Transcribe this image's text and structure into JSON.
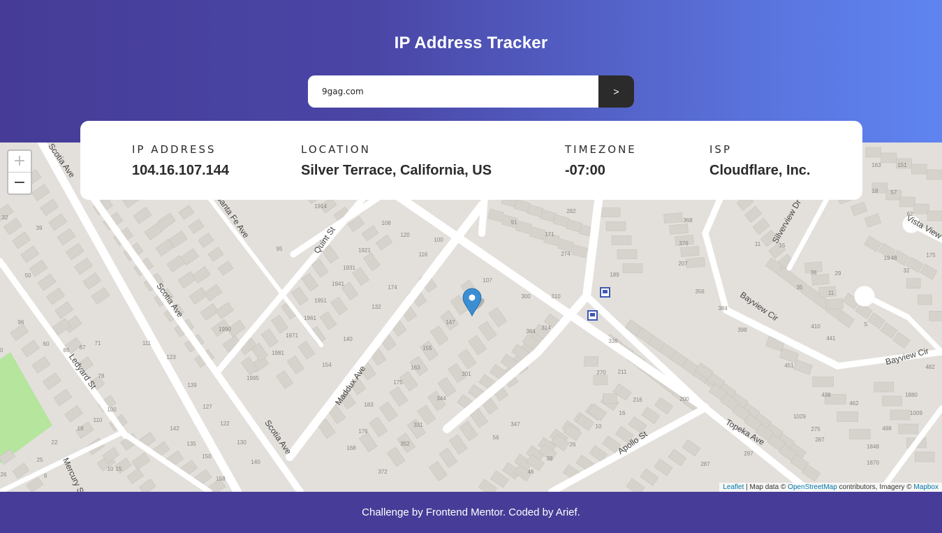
{
  "header": {
    "title": "IP Address Tracker"
  },
  "search": {
    "value": "9gag.com",
    "submit_label": ">"
  },
  "info": {
    "ip_label": "IP ADDRESS",
    "ip_value": "104.16.107.144",
    "location_label": "LOCATION",
    "location_value": "Silver Terrace, California, US",
    "timezone_label": "TIMEZONE",
    "timezone_value": "-07:00",
    "isp_label": "ISP",
    "isp_value": "Cloudflare, Inc."
  },
  "map": {
    "zoom_in": "+",
    "zoom_out": "−",
    "attribution": {
      "leaflet": "Leaflet",
      "sep": " | Map data © ",
      "osm": "OpenStreetMap",
      "mid": " contributors, Imagery © ",
      "mapbox": "Mapbox"
    },
    "streets": [
      "Scotia Ave",
      "Santa Fe Ave",
      "Quint St",
      "Maddux Ave",
      "Ledyard St",
      "Silverview Dr",
      "Vista View Ct",
      "Bayview Cir",
      "Apollo St",
      "Topeka Ave",
      "Mercury St"
    ],
    "numbers": [
      "107",
      "120",
      "116",
      "100",
      "108",
      "1921",
      "1931",
      "1941",
      "1951",
      "1961",
      "1971",
      "1981",
      "1995",
      "1990",
      "1914",
      "95",
      "91",
      "171",
      "282",
      "274",
      "189",
      "207",
      "376",
      "368",
      "356",
      "384",
      "398",
      "410",
      "441",
      "451",
      "438",
      "462",
      "482",
      "498",
      "1848",
      "1870",
      "1880",
      "1009",
      "1029",
      "275",
      "287",
      "297",
      "287",
      "270",
      "211",
      "216",
      "16",
      "10",
      "26",
      "38",
      "46",
      "56",
      "347",
      "331",
      "344",
      "352",
      "372",
      "384",
      "314",
      "310",
      "300",
      "174",
      "132",
      "140",
      "154",
      "168",
      "176",
      "183",
      "175",
      "163",
      "155",
      "147",
      "139",
      "127",
      "122",
      "130",
      "140",
      "150",
      "158",
      "135",
      "142",
      "123",
      "111",
      "110",
      "100",
      "96",
      "86",
      "78",
      "71",
      "67",
      "60",
      "50",
      "40",
      "39",
      "32",
      "25",
      "22",
      "18",
      "10",
      "15",
      "9",
      "26",
      "301",
      "336",
      "200",
      "5",
      "11",
      "29",
      "38",
      "35",
      "15",
      "11",
      "19",
      "32",
      "48",
      "62",
      "57",
      "18",
      "22",
      "151",
      "163",
      "175",
      "3"
    ],
    "marker_icon": "map-pin-icon",
    "bus_icon": "bus-stop-icon",
    "colors": {
      "land": "#e3e0dc",
      "building": "#d6d2cc",
      "road": "#ffffff",
      "park": "#b6e59e"
    }
  },
  "footer": {
    "text": "Challenge by Frontend Mentor. Coded by Arief."
  }
}
